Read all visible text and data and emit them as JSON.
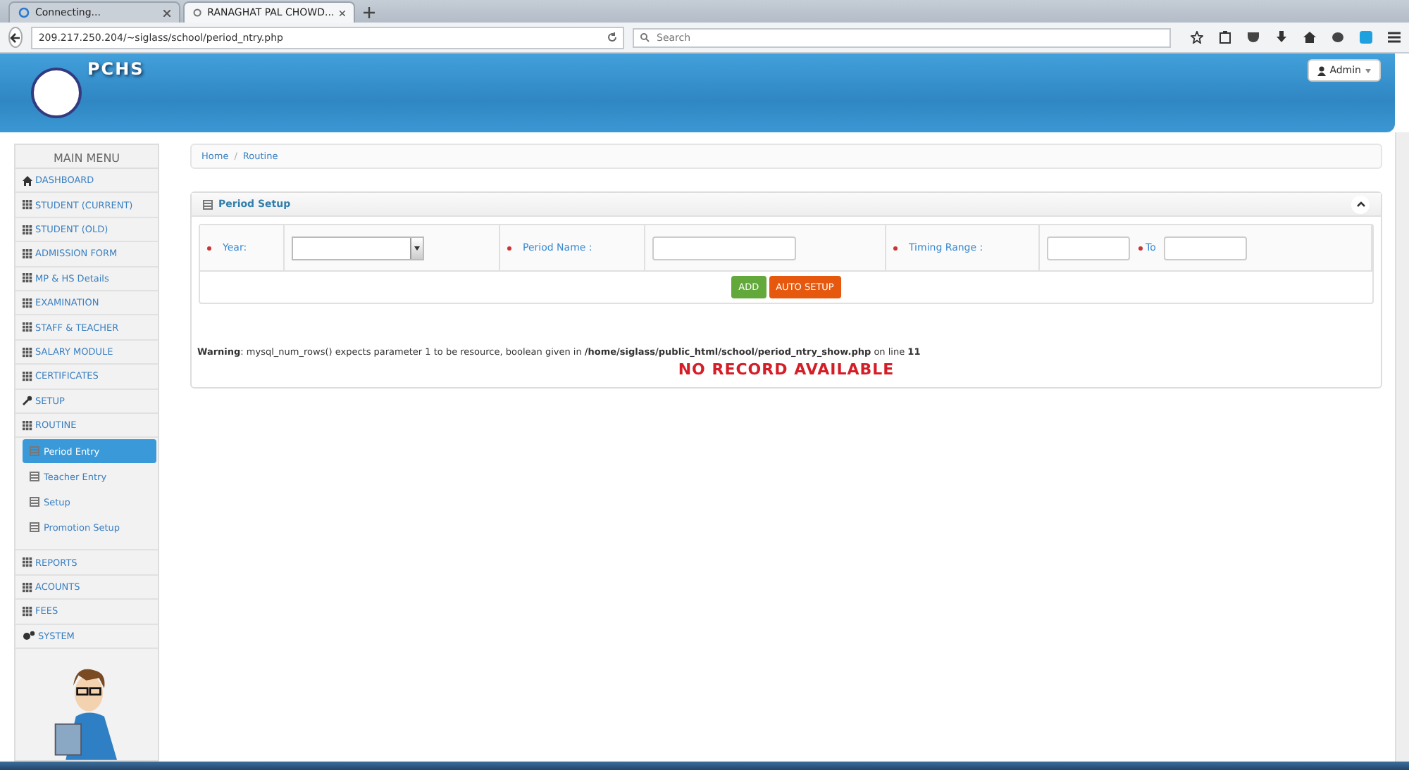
{
  "browser": {
    "tabs": [
      {
        "label": "Connecting...",
        "selected": false
      },
      {
        "label": "RANAGHAT PAL CHOWD...",
        "selected": true
      }
    ],
    "url": "209.217.250.204/~siglass/school/period_ntry.php",
    "search": {
      "placeholder": "Search"
    }
  },
  "header": {
    "logo_text": "PCHS",
    "user_menu": "Admin"
  },
  "sidebar": {
    "title": "MAIN MENU",
    "items": [
      {
        "label": "DASHBOARD",
        "kind": "home"
      },
      {
        "label": "STUDENT (CURRENT)",
        "kind": "grid"
      },
      {
        "label": "STUDENT (OLD)",
        "kind": "grid"
      },
      {
        "label": "ADMISSION FORM",
        "kind": "grid"
      },
      {
        "label": "MP & HS Details",
        "kind": "grid"
      },
      {
        "label": "EXAMINATION",
        "kind": "grid"
      },
      {
        "label": "STAFF & TEACHER",
        "kind": "grid"
      },
      {
        "label": "SALARY MODULE",
        "kind": "grid"
      },
      {
        "label": "CERTIFICATES",
        "kind": "grid"
      },
      {
        "label": "SETUP",
        "kind": "wrench"
      },
      {
        "label": "ROUTINE",
        "kind": "grid",
        "children": [
          {
            "label": "Period Entry",
            "selected": true
          },
          {
            "label": "Teacher Entry",
            "selected": false
          },
          {
            "label": "Setup",
            "selected": false
          },
          {
            "label": "Promotion Setup",
            "selected": false
          }
        ]
      },
      {
        "label": "REPORTS",
        "kind": "grid"
      },
      {
        "label": "ACOUNTS",
        "kind": "grid"
      },
      {
        "label": "FEES",
        "kind": "grid"
      },
      {
        "label": "SYSTEM",
        "kind": "gears"
      }
    ]
  },
  "breadcrumb": {
    "items": [
      "Home",
      "Routine"
    ],
    "separator": "/"
  },
  "panel": {
    "title": "Period Setup",
    "fields": [
      {
        "label": "Year:",
        "kind": "select"
      },
      {
        "label": "Period Name :",
        "kind": "text"
      },
      {
        "label": "Timing Range :",
        "kind": "range",
        "to_label": "To"
      }
    ],
    "buttons": [
      {
        "label": "ADD",
        "kind": "success"
      },
      {
        "label": "AUTO SETUP",
        "kind": "warning"
      }
    ],
    "warning": {
      "label": "Warning",
      "message": ": mysql_num_rows() expects parameter 1 to be resource, boolean given in ",
      "path": "/home/siglass/public_html/school/period_ntry_show.php",
      "line_text": " on line ",
      "line": "11"
    },
    "empty_message": "NO RECORD AVAILABLE"
  }
}
